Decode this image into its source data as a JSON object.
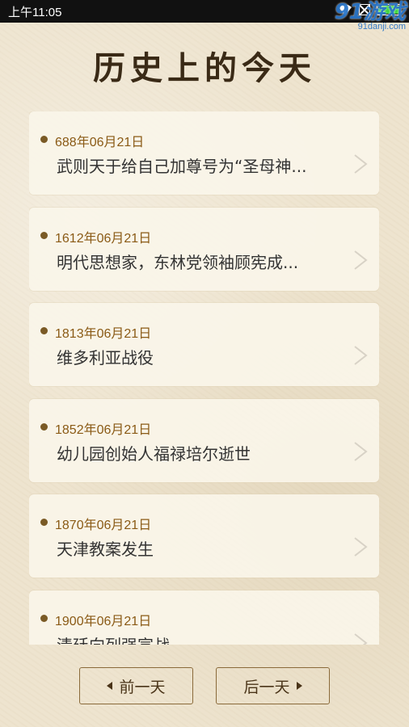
{
  "status_bar": {
    "time": "上午11:05",
    "icons": [
      "wifi-icon",
      "sim-icon",
      "battery-icon"
    ],
    "battery_color": "#3fd53f"
  },
  "watermark": {
    "logo_text": "91游戏",
    "site": "91danji.com"
  },
  "title": "历史上的今天",
  "events": [
    {
      "date": "688年06月21日",
      "text": "武则天于给自己加尊号为“圣母神..."
    },
    {
      "date": "1612年06月21日",
      "text": "明代思想家，东林党领袖顾宪成..."
    },
    {
      "date": "1813年06月21日",
      "text": "维多利亚战役"
    },
    {
      "date": "1852年06月21日",
      "text": "幼儿园创始人福禄培尔逝世"
    },
    {
      "date": "1870年06月21日",
      "text": "天津教案发生"
    },
    {
      "date": "1900年06月21日",
      "text": "清廷向列强宣战"
    }
  ],
  "nav": {
    "prev_label": "前一天",
    "next_label": "后一天"
  },
  "colors": {
    "accent": "#8a5a15",
    "border": "#8a6a3a",
    "background": "#eee4cf"
  }
}
